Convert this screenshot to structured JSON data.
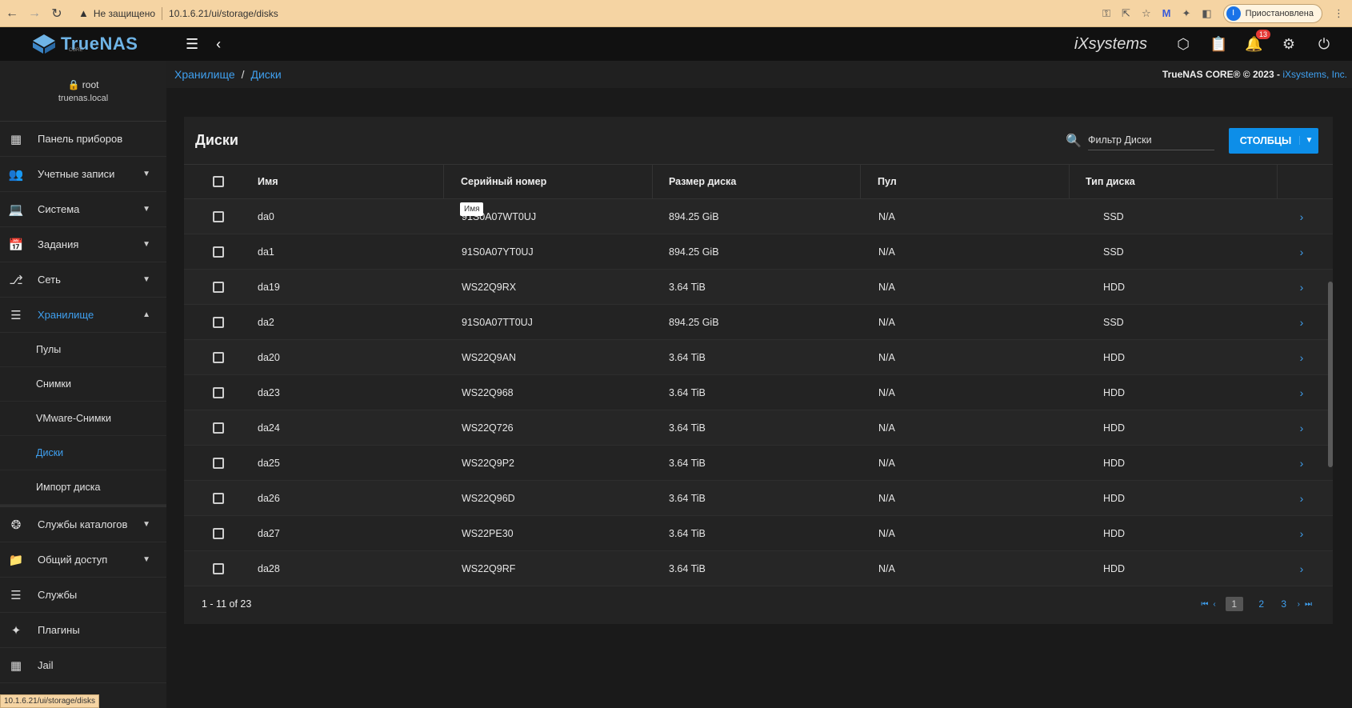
{
  "browser": {
    "security": "Не защищено",
    "url": "10.1.6.21/ui/storage/disks",
    "profile_initial": "I",
    "profile_label": "Приостановлена"
  },
  "app": {
    "logo_text": "TrueNAS",
    "logo_sub": "CORE",
    "vendor_logo": "iXsystems",
    "notifications_count": "13"
  },
  "user": {
    "name": "root",
    "host": "truenas.local"
  },
  "sidebar": {
    "items": [
      {
        "label": "Панель приборов",
        "icon": "dashboard-icon"
      },
      {
        "label": "Учетные записи",
        "icon": "accounts-icon"
      },
      {
        "label": "Система",
        "icon": "system-icon"
      },
      {
        "label": "Задания",
        "icon": "tasks-icon"
      },
      {
        "label": "Сеть",
        "icon": "network-icon"
      },
      {
        "label": "Хранилище",
        "icon": "storage-icon"
      }
    ],
    "storage_sub": [
      "Пулы",
      "Снимки",
      "VMware-Снимки",
      "Диски",
      "Импорт диска"
    ],
    "items_after": [
      {
        "label": "Службы каталогов",
        "icon": "directory-icon"
      },
      {
        "label": "Общий доступ",
        "icon": "sharing-icon"
      },
      {
        "label": "Службы",
        "icon": "services-icon"
      },
      {
        "label": "Плагины",
        "icon": "plugins-icon"
      },
      {
        "label": "Jail",
        "icon": "jail-icon"
      }
    ]
  },
  "status_bar_url": "10.1.6.21/ui/storage/disks",
  "breadcrumb": {
    "parent": "Хранилище",
    "sep": "/",
    "current": "Диски"
  },
  "copyright": {
    "text": "TrueNAS CORE® © 2023 - ",
    "link": "iXsystems, Inc."
  },
  "card": {
    "title": "Диски",
    "filter_placeholder": "Фильтр Диски",
    "columns_button": "СТОЛБЦЫ",
    "tooltip": "Имя"
  },
  "table": {
    "headers": {
      "name": "Имя",
      "serial": "Серийный номер",
      "size": "Размер диска",
      "pool": "Пул",
      "type": "Тип диска"
    },
    "rows": [
      {
        "name": "da0",
        "serial": "91S0A07WT0UJ",
        "size": "894.25 GiB",
        "pool": "N/A",
        "type": "SSD"
      },
      {
        "name": "da1",
        "serial": "91S0A07YT0UJ",
        "size": "894.25 GiB",
        "pool": "N/A",
        "type": "SSD"
      },
      {
        "name": "da19",
        "serial": "WS22Q9RX",
        "size": "3.64 TiB",
        "pool": "N/A",
        "type": "HDD"
      },
      {
        "name": "da2",
        "serial": "91S0A07TT0UJ",
        "size": "894.25 GiB",
        "pool": "N/A",
        "type": "SSD"
      },
      {
        "name": "da20",
        "serial": "WS22Q9AN",
        "size": "3.64 TiB",
        "pool": "N/A",
        "type": "HDD"
      },
      {
        "name": "da23",
        "serial": "WS22Q968",
        "size": "3.64 TiB",
        "pool": "N/A",
        "type": "HDD"
      },
      {
        "name": "da24",
        "serial": "WS22Q726",
        "size": "3.64 TiB",
        "pool": "N/A",
        "type": "HDD"
      },
      {
        "name": "da25",
        "serial": "WS22Q9P2",
        "size": "3.64 TiB",
        "pool": "N/A",
        "type": "HDD"
      },
      {
        "name": "da26",
        "serial": "WS22Q96D",
        "size": "3.64 TiB",
        "pool": "N/A",
        "type": "HDD"
      },
      {
        "name": "da27",
        "serial": "WS22PE30",
        "size": "3.64 TiB",
        "pool": "N/A",
        "type": "HDD"
      },
      {
        "name": "da28",
        "serial": "WS22Q9RF",
        "size": "3.64 TiB",
        "pool": "N/A",
        "type": "HDD"
      }
    ]
  },
  "pagination": {
    "range": "1 - 11 of 23",
    "pages": [
      "1",
      "2",
      "3"
    ],
    "current": "1"
  },
  "colors": {
    "accent": "#3fa0f0",
    "button": "#0d8ee8",
    "badge": "#e53935"
  }
}
